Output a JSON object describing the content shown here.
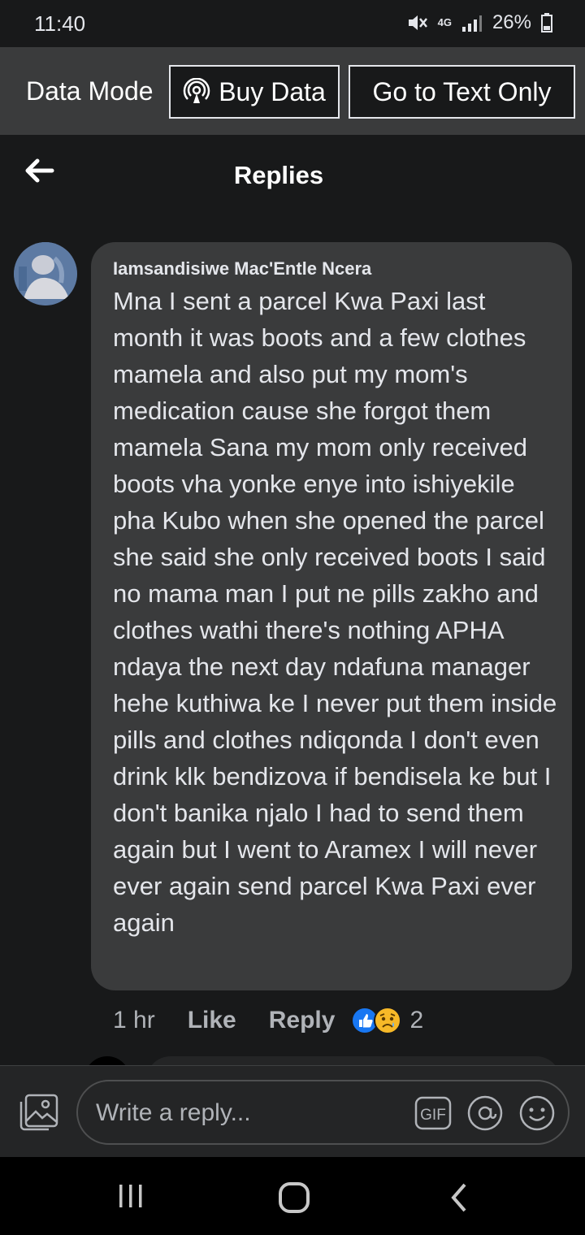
{
  "status_bar": {
    "time": "11:40",
    "network": "4G",
    "battery": "26%"
  },
  "data_mode_bar": {
    "label": "Data Mode",
    "buy_data": "Buy Data",
    "text_only": "Go to Text Only"
  },
  "header": {
    "title": "Replies"
  },
  "comment": {
    "author": "Iamsandisiwe Mac'Entle Ncera",
    "text": "Mna I sent a parcel Kwa Paxi last month it was boots and a few clothes mamela and also put my mom's medication cause she forgot them mamela Sana my mom only received boots vha yonke enye into ishiyekile pha Kubo when she opened the parcel she said she only received boots I said no mama man I put ne pills zakho and clothes wathi there's nothing APHA ndaya the next day ndafuna manager hehe kuthiwa ke I never put them inside pills and clothes ndiqonda I don't even drink klk bendizova if bendisela ke but I don't banika njalo I had to send them again but I went to Aramex I will never ever again send parcel Kwa Paxi ever again",
    "time": "1 hr",
    "like": "Like",
    "reply": "Reply",
    "reaction_count": "2",
    "reactions": [
      "like-icon",
      "sad-icon"
    ]
  },
  "composer": {
    "placeholder": "Write a reply...",
    "gif": "GIF"
  },
  "colors": {
    "background": "#18191a",
    "bubble": "#3a3b3c",
    "like_blue": "#1877f2"
  }
}
